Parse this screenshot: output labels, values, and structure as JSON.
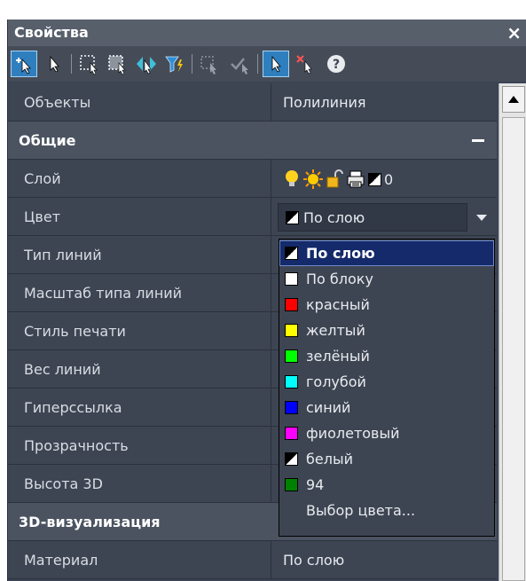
{
  "panel": {
    "title": "Свойства",
    "close_glyph": "×"
  },
  "toolbar": {
    "icons": [
      "add-select-icon",
      "select-icon",
      "window-select-icon",
      "crossing-select-icon",
      "invert-select-icon",
      "filter-icon",
      "selection-set-icon",
      "accept-select-icon",
      "pick-add-icon",
      "deselect-icon",
      "help-icon"
    ]
  },
  "properties": {
    "objects": {
      "label": "Объекты",
      "value": "Полилиния"
    },
    "section_general": "Общие",
    "layer": {
      "label": "Слой",
      "value": "0"
    },
    "color": {
      "label": "Цвет",
      "value": "По слою"
    },
    "linetype": {
      "label": "Тип линий"
    },
    "linetype_scale": {
      "label": "Масштаб типа линий"
    },
    "plot_style": {
      "label": "Стиль печати"
    },
    "lineweight": {
      "label": "Вес линий"
    },
    "hyperlink": {
      "label": "Гиперссылка"
    },
    "transparency": {
      "label": "Прозрачность"
    },
    "height3d": {
      "label": "Высота 3D"
    },
    "section_3d": "3D-визуализация",
    "material": {
      "label": "Материал",
      "value": "По слою"
    }
  },
  "dropdown": {
    "options": [
      {
        "label": "По слою",
        "color": "bylayer",
        "selected": true
      },
      {
        "label": "По блоку",
        "color": "#ffffff"
      },
      {
        "label": "красный",
        "color": "#ff0000"
      },
      {
        "label": "желтый",
        "color": "#ffff00"
      },
      {
        "label": "зелёный",
        "color": "#00ff00"
      },
      {
        "label": "голубой",
        "color": "#00ffff"
      },
      {
        "label": "синий",
        "color": "#0000ff"
      },
      {
        "label": "фиолетовый",
        "color": "#ff00ff"
      },
      {
        "label": "белый",
        "color": "bylayer"
      },
      {
        "label": "94",
        "color": "#008000"
      }
    ],
    "more": "Выбор цвета..."
  },
  "colors": {
    "panel_bg": "#3b4453",
    "selection": "#142a6a",
    "accent": "#2f7fbf"
  }
}
